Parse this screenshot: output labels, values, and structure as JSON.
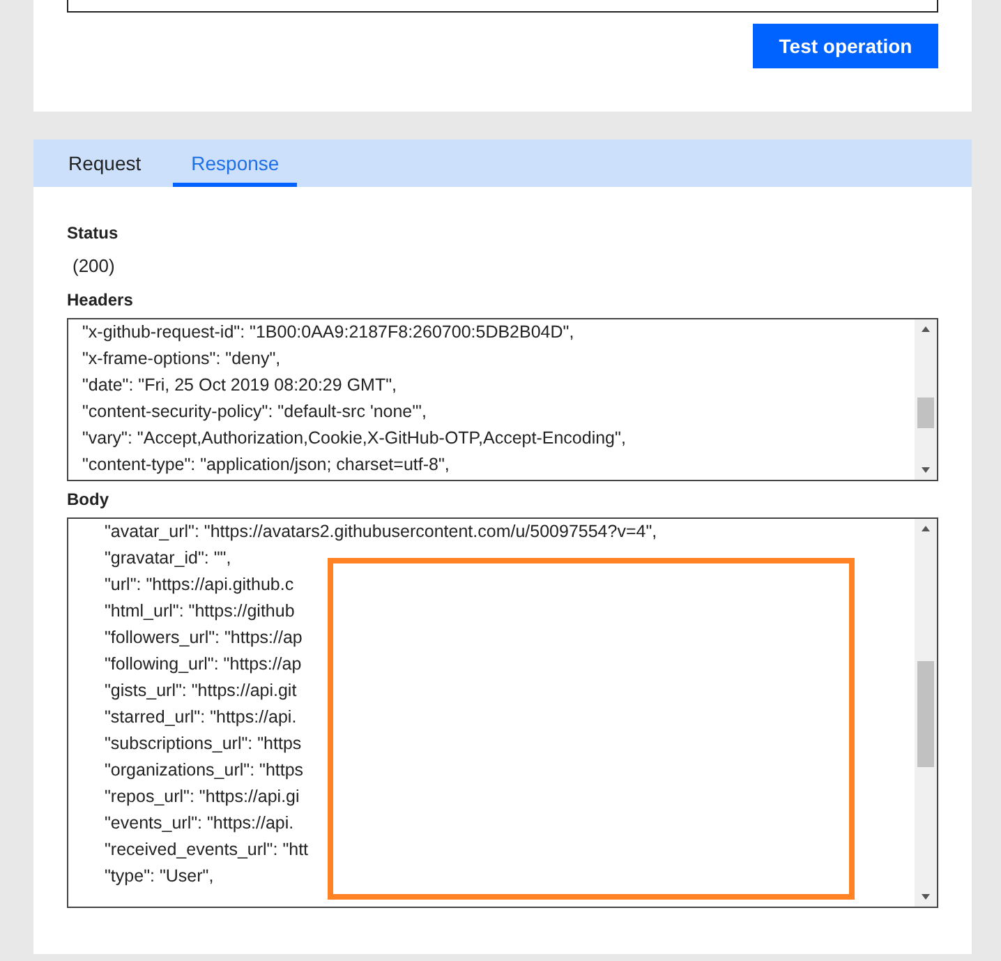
{
  "top_panel": {
    "button": "Test operation"
  },
  "tabs": [
    {
      "label": "Request",
      "selected": false
    },
    {
      "label": "Response",
      "selected": true
    }
  ],
  "status": {
    "label": "Status",
    "value": "(200)"
  },
  "headers": {
    "label": "Headers",
    "lines": [
      "\"x-github-request-id\": \"1B00:0AA9:2187F8:260700:5DB2B04D\",",
      "\"x-frame-options\": \"deny\",",
      "\"date\": \"Fri, 25 Oct 2019 08:20:29 GMT\",",
      "\"content-security-policy\": \"default-src 'none'\",",
      "\"vary\": \"Accept,Authorization,Cookie,X-GitHub-OTP,Accept-Encoding\",",
      "\"content-type\": \"application/json; charset=utf-8\","
    ]
  },
  "body": {
    "label": "Body",
    "lines": [
      "\"avatar_url\": \"https://avatars2.githubusercontent.com/u/50097554?v=4\",",
      "\"gravatar_id\": \"\",",
      "\"url\": \"https://api.github.c",
      "\"html_url\": \"https://github",
      "\"followers_url\": \"https://ap",
      "\"following_url\": \"https://ap",
      "\"gists_url\": \"https://api.git",
      "\"starred_url\": \"https://api.",
      "\"subscriptions_url\": \"https",
      "\"organizations_url\": \"https",
      "\"repos_url\": \"https://api.gi",
      "\"events_url\": \"https://api.",
      "\"received_events_url\": \"htt",
      "\"type\": \"User\","
    ]
  }
}
